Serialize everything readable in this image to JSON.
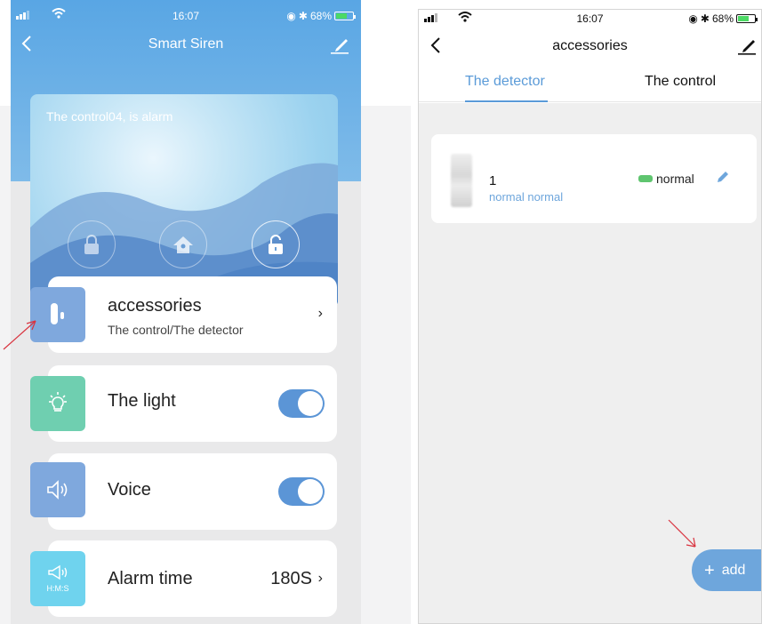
{
  "left": {
    "status": {
      "time": "16:07",
      "battery": "68%"
    },
    "nav": {
      "title": "Smart Siren"
    },
    "hero": {
      "message": "The control04, is alarm"
    },
    "rows": {
      "accessories": {
        "label": "accessories",
        "sub": "The control/The detector",
        "chevron": "›"
      },
      "light": {
        "label": "The light",
        "on": true
      },
      "voice": {
        "label": "Voice",
        "on": true
      },
      "alarm": {
        "label": "Alarm time",
        "value": "180S",
        "chevron": "›",
        "icon_caption": "H:M:S"
      }
    }
  },
  "right": {
    "status": {
      "time": "16:07",
      "battery": "68%"
    },
    "nav": {
      "title": "accessories"
    },
    "tabs": [
      {
        "label": "The detector",
        "active": true
      },
      {
        "label": "The control",
        "active": false
      }
    ],
    "detector": {
      "name": "1",
      "sub": "normal normal",
      "status": "normal"
    },
    "add_button": {
      "plus": "+",
      "label": "add"
    }
  },
  "colors": {
    "accent": "#5b9bd8",
    "header_blue": "#59a6e4",
    "toggle_on": "#5b95d6",
    "battery_green": "#4cd964",
    "annotation_red": "#d9333f",
    "icon_blue": "#7fa8dd",
    "icon_teal": "#6fcfb0",
    "icon_cyan": "#6fd3ee"
  },
  "icons": [
    "back-icon",
    "edit-icon",
    "lock-icon",
    "home-icon",
    "unlock-icon",
    "door-sensor-icon",
    "bulb-icon",
    "speaker-icon",
    "megaphone-icon",
    "pencil-icon",
    "wifi-icon",
    "signal-icon",
    "bluetooth-icon",
    "battery-icon"
  ]
}
